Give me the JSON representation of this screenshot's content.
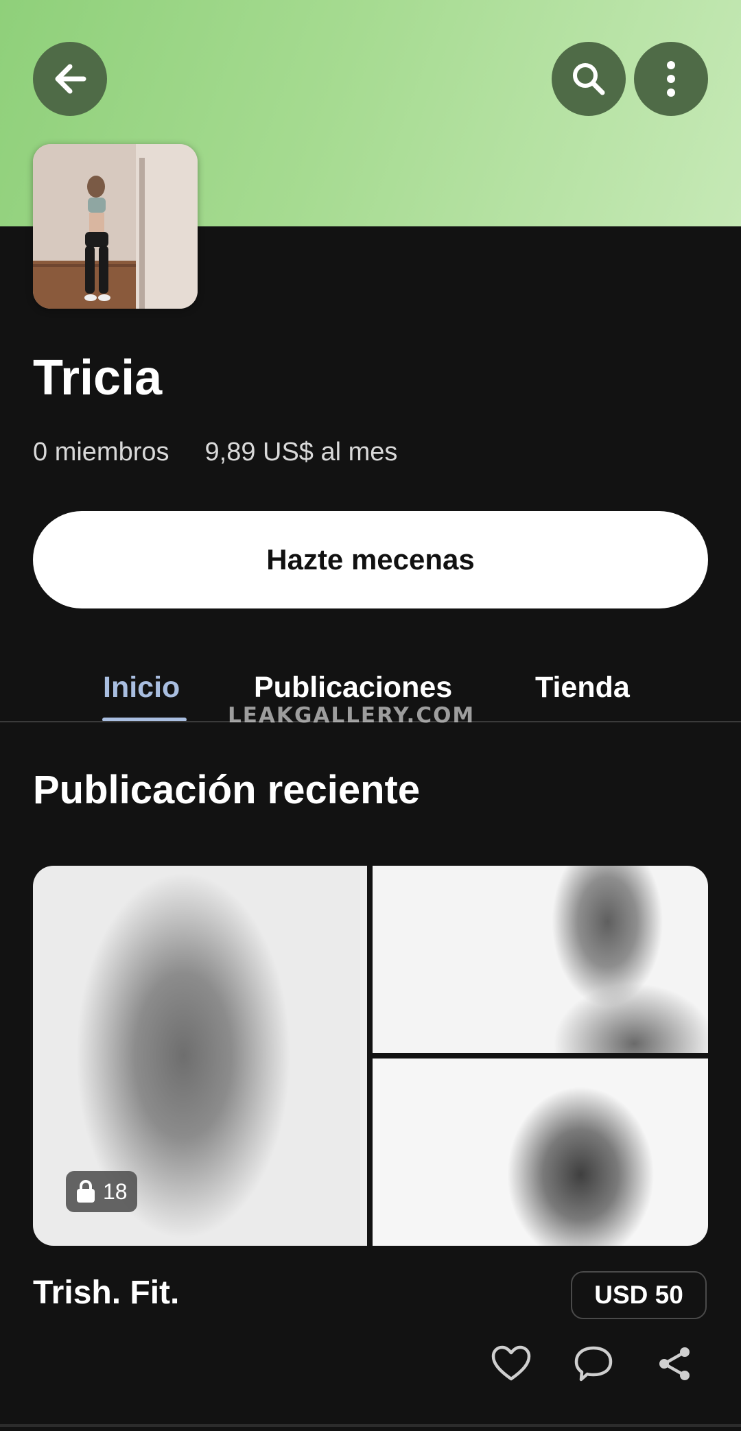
{
  "header": {
    "back_icon": "arrow-left-icon",
    "search_icon": "search-icon",
    "more_icon": "more-vertical-icon",
    "banner_color": "#a6db91"
  },
  "profile": {
    "name": "Tricia",
    "members": "0 miembros",
    "price": "9,89 US$ al mes",
    "join_label": "Hazte mecenas"
  },
  "tabs": [
    {
      "label": "Inicio",
      "active": true
    },
    {
      "label": "Publicaciones",
      "active": false
    },
    {
      "label": "Tienda",
      "active": false
    }
  ],
  "watermark": "LEAKGALLERY.COM",
  "recent": {
    "section_title": "Publicación reciente",
    "locked_count": "18",
    "post_title": "Trish. Fit.",
    "price_badge": "USD 50",
    "actions": [
      "heart-icon",
      "comment-icon",
      "share-icon"
    ]
  },
  "colors": {
    "background": "#121212",
    "accent_tab": "#a9bee0",
    "button_circle": "#4f6b47"
  }
}
